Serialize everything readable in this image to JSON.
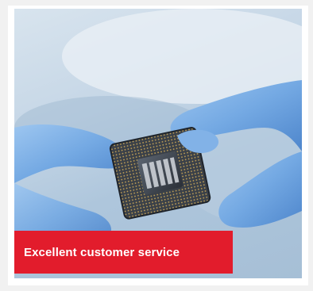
{
  "tile": {
    "image_icon": "processor-chip-in-gloved-hands",
    "caption": "Excellent customer service",
    "caption_bg": "#e21c2c",
    "caption_color": "#ffffff",
    "page_bg": "#f1f1f1"
  }
}
